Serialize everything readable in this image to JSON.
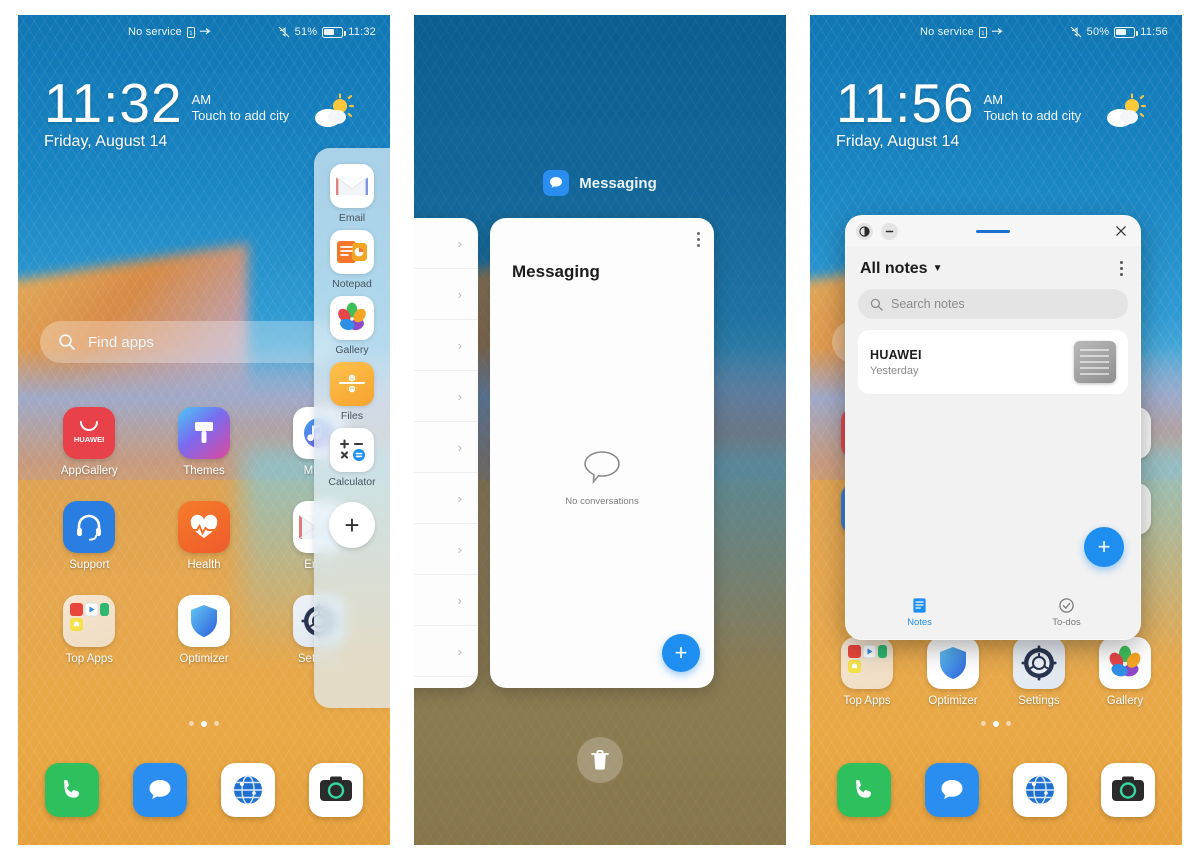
{
  "panels": [
    {
      "id": "lockscreen-with-app-drawer",
      "status": {
        "carrier": "No service",
        "battery": "51%",
        "time": "11:32"
      },
      "clock": {
        "time": "11:32",
        "ampm": "AM",
        "city_hint": "Touch to add city",
        "date": "Friday, August 14"
      },
      "search": {
        "placeholder": "Find apps"
      },
      "apps": [
        {
          "label": "AppGallery",
          "icon": "appgallery-icon"
        },
        {
          "label": "Themes",
          "icon": "themes-icon"
        },
        {
          "label": "Music",
          "icon": "music-icon"
        },
        {
          "label": "Support",
          "icon": "support-icon"
        },
        {
          "label": "Health",
          "icon": "health-icon"
        },
        {
          "label": "Email",
          "icon": "email-icon"
        },
        {
          "label": "Top Apps",
          "icon": "top-apps-folder-icon"
        },
        {
          "label": "Optimizer",
          "icon": "optimizer-icon"
        },
        {
          "label": "Settings",
          "icon": "settings-icon"
        }
      ],
      "drawer": {
        "items": [
          {
            "label": "Email",
            "icon": "email-icon"
          },
          {
            "label": "Notepad",
            "icon": "notepad-icon"
          },
          {
            "label": "Gallery",
            "icon": "gallery-icon"
          },
          {
            "label": "Files",
            "icon": "files-icon"
          },
          {
            "label": "Calculator",
            "icon": "calculator-icon"
          }
        ],
        "add_label": "+"
      },
      "dock": [
        {
          "label": "Phone",
          "icon": "phone-icon"
        },
        {
          "label": "Messaging",
          "icon": "messaging-icon"
        },
        {
          "label": "Browser",
          "icon": "browser-icon"
        },
        {
          "label": "Camera",
          "icon": "camera-icon"
        }
      ]
    },
    {
      "id": "recent-apps",
      "app_label": "Messaging",
      "freeform_icon": "floating-window-icon",
      "card": {
        "title": "Messaging",
        "empty_text": "No conversations",
        "fab_label": "+",
        "menu_icon": "kebab-menu-icon"
      },
      "clear_all_icon": "trash-icon",
      "highlight_color": "#bf1414"
    },
    {
      "id": "floating-notepad-window",
      "status": {
        "carrier": "No service",
        "battery": "50%",
        "time": "11:56"
      },
      "clock": {
        "time": "11:56",
        "ampm": "AM",
        "city_hint": "Touch to add city",
        "date": "Friday, August 14"
      },
      "window": {
        "expand_icon": "expand-window-icon",
        "minimize_icon": "minimize-icon",
        "close_icon": "close-icon",
        "title": "All notes",
        "caret": "▼",
        "menu_icon": "kebab-menu-icon",
        "search_placeholder": "Search notes",
        "notes": [
          {
            "title": "HUAWEI",
            "subtitle": "Yesterday"
          }
        ],
        "fab_label": "+",
        "tabs": [
          {
            "label": "Notes",
            "icon": "notes-icon",
            "active": true
          },
          {
            "label": "To-dos",
            "icon": "todos-icon",
            "active": false
          }
        ]
      },
      "apps_row": [
        {
          "label": "Top Apps",
          "icon": "top-apps-folder-icon"
        },
        {
          "label": "Optimizer",
          "icon": "optimizer-icon"
        },
        {
          "label": "Settings",
          "icon": "settings-icon"
        },
        {
          "label": "Gallery",
          "icon": "gallery-icon"
        }
      ],
      "dock": [
        {
          "label": "Phone",
          "icon": "phone-icon"
        },
        {
          "label": "Messaging",
          "icon": "messaging-icon"
        },
        {
          "label": "Browser",
          "icon": "browser-icon"
        },
        {
          "label": "Camera",
          "icon": "camera-icon"
        }
      ]
    }
  ]
}
